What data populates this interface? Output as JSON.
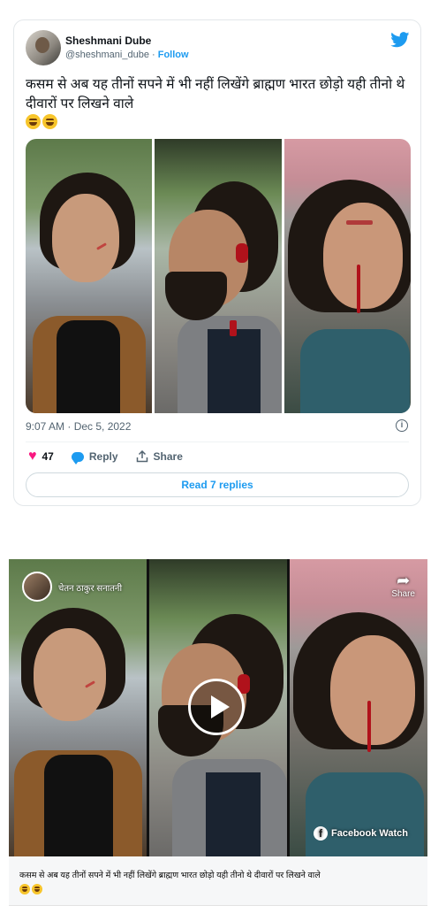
{
  "tweet": {
    "display_name": "Sheshmani Dube",
    "handle": "@sheshmani_dube",
    "separator": " · ",
    "follow_label": "Follow",
    "text": "कसम से अब यह तीनों सपने में भी नहीं लिखेंगे ब्राह्मण भारत छोड़ो यही तीनो थे दीवारों पर लिखने वाले",
    "emoji": [
      "grinning-face-emoji",
      "grinning-face-emoji"
    ],
    "timestamp": "9:07 AM · Dec 5, 2022",
    "likes_count": "47",
    "reply_label": "Reply",
    "share_label": "Share",
    "read_replies_label": "Read 7 replies",
    "icons": {
      "platform": "twitter-bird-icon",
      "like": "heart-icon",
      "reply": "speech-bubble-icon",
      "share": "share-upload-icon",
      "info": "info-icon"
    },
    "colors": {
      "accent": "#1d9bf0",
      "like": "#f91880",
      "muted": "#536471"
    }
  },
  "facebook_post": {
    "page_name": "चेतन ठाकुर सनातनी",
    "share_label": "Share",
    "watch_label": "Facebook Watch",
    "caption": "कसम से अब यह तीनों सपने में भी नहीं लिखेंगे ब्राह्मण भारत छोड़ो यही तीनो थे दीवारों पर लिखने वाले",
    "emoji": [
      "grinning-face-emoji",
      "grinning-face-emoji"
    ],
    "icons": {
      "share": "share-arrow-icon",
      "play": "play-icon",
      "brand": "facebook-logo-icon"
    }
  }
}
